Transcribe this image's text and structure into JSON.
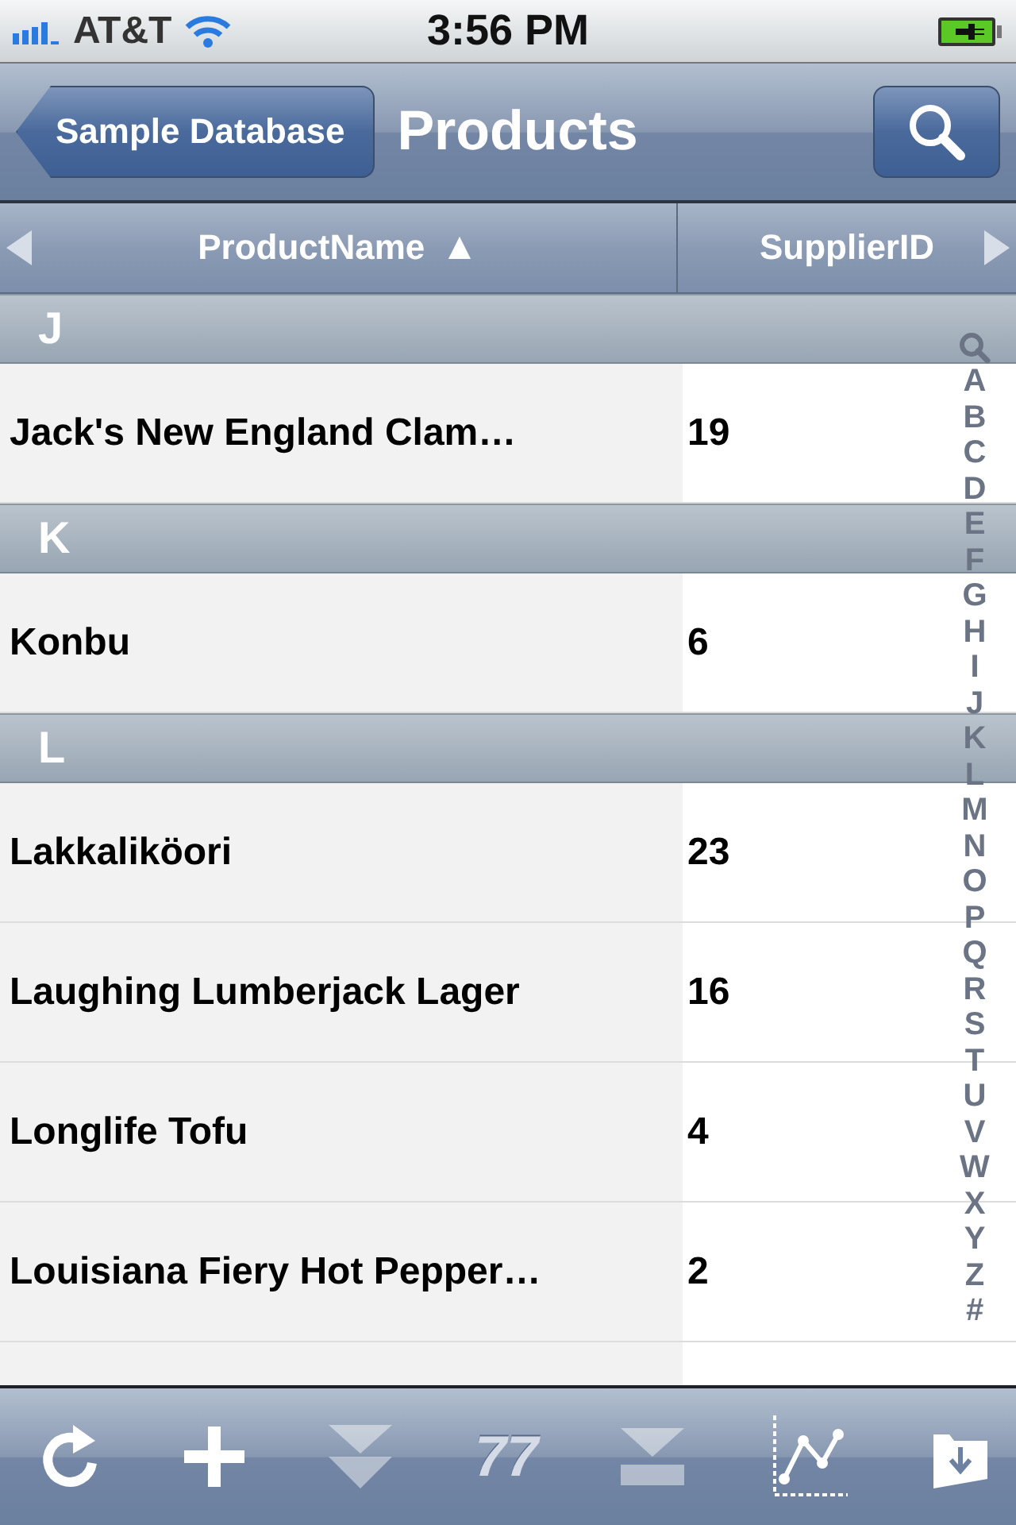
{
  "status_bar": {
    "carrier": "AT&T",
    "time": "3:56 PM"
  },
  "nav": {
    "back": "Sample Database",
    "title": "Products"
  },
  "columns": [
    {
      "label": "ProductName",
      "sort": "▲"
    },
    {
      "label": "SupplierID"
    }
  ],
  "sections": [
    {
      "letter": "J",
      "rows": [
        {
          "name": "Jack's New England Clam…",
          "supplier": "19"
        }
      ]
    },
    {
      "letter": "K",
      "rows": [
        {
          "name": "Konbu",
          "supplier": "6"
        }
      ]
    },
    {
      "letter": "L",
      "rows": [
        {
          "name": "Lakkaliköori",
          "supplier": "23"
        },
        {
          "name": "Laughing Lumberjack Lager",
          "supplier": "16"
        },
        {
          "name": "Longlife Tofu",
          "supplier": "4"
        },
        {
          "name": "Louisiana Fiery Hot Pepper…",
          "supplier": "2"
        }
      ]
    }
  ],
  "index": [
    "A",
    "B",
    "C",
    "D",
    "E",
    "F",
    "G",
    "H",
    "I",
    "J",
    "K",
    "L",
    "M",
    "N",
    "O",
    "P",
    "Q",
    "R",
    "S",
    "T",
    "U",
    "V",
    "W",
    "X",
    "Y",
    "Z",
    "#"
  ],
  "toolbar": [
    {
      "kind": "refresh",
      "disabled": false
    },
    {
      "kind": "add",
      "disabled": false
    },
    {
      "kind": "next-page",
      "disabled": true
    },
    {
      "kind": "count",
      "label": "77",
      "disabled": true
    },
    {
      "kind": "last-page",
      "disabled": true
    },
    {
      "kind": "chart",
      "disabled": false
    },
    {
      "kind": "export",
      "disabled": false
    }
  ]
}
